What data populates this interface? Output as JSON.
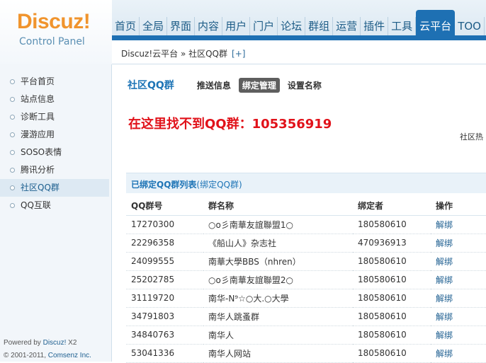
{
  "logo": {
    "title": "Discuz!",
    "subtitle": "Control Panel"
  },
  "nav": [
    {
      "label": "首页"
    },
    {
      "label": "全局"
    },
    {
      "label": "界面"
    },
    {
      "label": "内容"
    },
    {
      "label": "用户"
    },
    {
      "label": "门户"
    },
    {
      "label": "论坛"
    },
    {
      "label": "群组"
    },
    {
      "label": "运营"
    },
    {
      "label": "插件"
    },
    {
      "label": "工具"
    },
    {
      "label": "云平台",
      "active": true
    },
    {
      "label": "TOO"
    }
  ],
  "breadcrumb": {
    "text": "Discuz!云平台 » 社区QQ群",
    "add_label": "[+]"
  },
  "sidebar": {
    "items": [
      {
        "label": "平台首页"
      },
      {
        "label": "站点信息"
      },
      {
        "label": "诊断工具"
      },
      {
        "label": "漫游应用"
      },
      {
        "label": "SOSO表情"
      },
      {
        "label": "腾讯分析"
      },
      {
        "label": "社区QQ群",
        "active": true
      },
      {
        "label": "QQ互联"
      }
    ],
    "footer": {
      "powered_prefix": "Powered by ",
      "powered_brand": "Discuz!",
      "powered_version": " X2",
      "copyright_prefix": "© 2001-2011, ",
      "copyright_company": "Comsenz Inc."
    }
  },
  "main": {
    "title": "社区QQ群",
    "tabs": [
      {
        "label": "推送信息"
      },
      {
        "label": "绑定管理",
        "active": true
      },
      {
        "label": "设置名称"
      }
    ],
    "notice": "在这里找不到QQ群：105356919",
    "side_cut_text": "社区热",
    "list": {
      "title": "已绑定QQ群列表",
      "title_sub": "(绑定QQ群)",
      "columns": [
        "QQ群号",
        "群名称",
        "绑定者",
        "操作"
      ],
      "rows": [
        [
          "17270300",
          "○o彡南華友誼聯盟1○",
          "180580610",
          "解绑"
        ],
        [
          "22296358",
          "《船山人》杂志社",
          "470936913",
          "解绑"
        ],
        [
          "24099555",
          "南華大學BBS（nhren）",
          "180580610",
          "解绑"
        ],
        [
          "25202785",
          "○o彡南華友誼聯盟2○",
          "180580610",
          "解绑"
        ],
        [
          "31119720",
          "南华-N⁹☆○大.○大學",
          "180580610",
          "解绑"
        ],
        [
          "34791803",
          "南华人跳蚤群",
          "180580610",
          "解绑"
        ],
        [
          "34840763",
          "南华人",
          "180580610",
          "解绑"
        ],
        [
          "53041336",
          "南华人网站",
          "180580610",
          "解绑"
        ]
      ]
    }
  },
  "colors": {
    "brand_orange": "#f0942d",
    "nav_blue": "#1e70b3",
    "notice_red": "#e1121a",
    "link_blue": "#1d74b6"
  }
}
